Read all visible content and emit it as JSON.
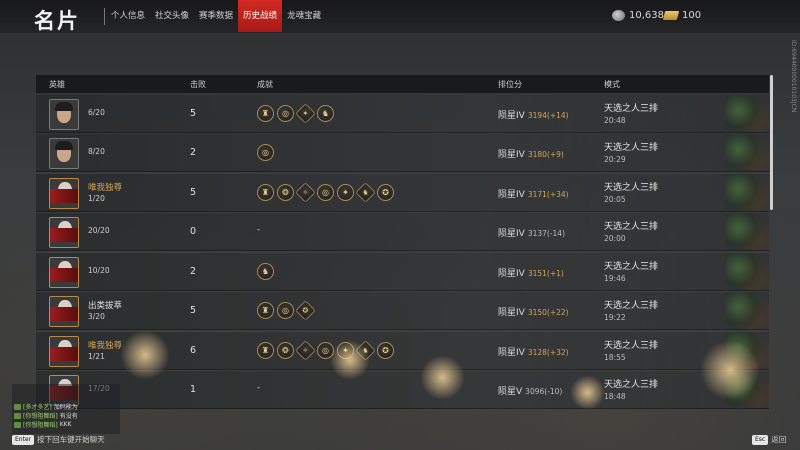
{
  "header": {
    "title": "名片",
    "tabs": [
      {
        "label": "个人信息",
        "active": false
      },
      {
        "label": "社交头像",
        "active": false
      },
      {
        "label": "赛季数据",
        "active": false
      },
      {
        "label": "历史战绩",
        "active": true
      },
      {
        "label": "龙魂宝藏",
        "active": false
      }
    ],
    "currency": [
      {
        "icon": "silver-coin-icon",
        "value": "10,638"
      },
      {
        "icon": "gold-ingot-icon",
        "value": "100"
      }
    ]
  },
  "table": {
    "columns": [
      "英雄",
      "击败",
      "成就",
      "排位分",
      "模式"
    ],
    "rows": [
      {
        "name": "",
        "rank": "6/20",
        "kills": "5",
        "achievements": [
          "shield",
          "spiral",
          "crest",
          "tower"
        ],
        "tier": "陨星IV",
        "score": "3194(+14)",
        "positive": true,
        "mode": "天选之人三排",
        "time": "20:48",
        "avatar": "male"
      },
      {
        "name": "",
        "rank": "8/20",
        "kills": "2",
        "achievements": [
          "spiral"
        ],
        "tier": "陨星IV",
        "score": "3180(+9)",
        "positive": true,
        "mode": "天选之人三排",
        "time": "20:29",
        "avatar": "male"
      },
      {
        "name": "唯我独尊",
        "rank": "1/20",
        "kills": "5",
        "achievements": [
          "shield",
          "swirl",
          "claw",
          "spiral",
          "crest",
          "tower",
          "pin"
        ],
        "tier": "陨星IV",
        "score": "3171(+34)",
        "positive": true,
        "mode": "天选之人三排",
        "time": "20:05",
        "avatar": "red",
        "name_color": "gold"
      },
      {
        "name": "",
        "rank": "20/20",
        "kills": "0",
        "achievements": [],
        "tier": "陨星IV",
        "score": "3137(-14)",
        "positive": false,
        "mode": "天选之人三排",
        "time": "20:00",
        "avatar": "red"
      },
      {
        "name": "",
        "rank": "10/20",
        "kills": "2",
        "achievements": [
          "tower"
        ],
        "tier": "陨星IV",
        "score": "3151(+1)",
        "positive": true,
        "mode": "天选之人三排",
        "time": "19:46",
        "avatar": "red"
      },
      {
        "name": "出类拔萃",
        "rank": "3/20",
        "kills": "5",
        "achievements": [
          "shield",
          "spiral",
          "pin"
        ],
        "tier": "陨星IV",
        "score": "3150(+22)",
        "positive": true,
        "mode": "天选之人三排",
        "time": "19:22",
        "avatar": "red",
        "name_color": "white"
      },
      {
        "name": "唯我独尊",
        "rank": "1/21",
        "kills": "6",
        "achievements": [
          "shield",
          "swirl",
          "claw",
          "spiral",
          "crest",
          "tower",
          "pin"
        ],
        "tier": "陨星IV",
        "score": "3128(+32)",
        "positive": true,
        "mode": "天选之人三排",
        "time": "18:55",
        "avatar": "red",
        "name_color": "gold"
      },
      {
        "name": "",
        "rank": "17/20",
        "kills": "1",
        "achievements": [],
        "tier": "陨星V",
        "score": "3096(-10)",
        "positive": false,
        "mode": "天选之人三排",
        "time": "18:48",
        "avatar": "red"
      }
    ],
    "empty_achievement": "-"
  },
  "side_code": "ID:69440000010103JCN",
  "chat": [
    {
      "channel": "[多才多艺]",
      "user": "加码能为",
      "text": ""
    },
    {
      "channel": "[你想阻舞蹈]",
      "user": "",
      "text": "有没有"
    },
    {
      "channel": "[你想阻舞蹈]",
      "user": "",
      "text": "KKK"
    }
  ],
  "footer": {
    "enter_key": "Enter",
    "enter_hint": "按下回车键开始聊天",
    "esc_key": "Esc",
    "esc_hint": "返回"
  },
  "colors": {
    "accent_red": "#c8221d",
    "gold_text": "#d4a456"
  }
}
